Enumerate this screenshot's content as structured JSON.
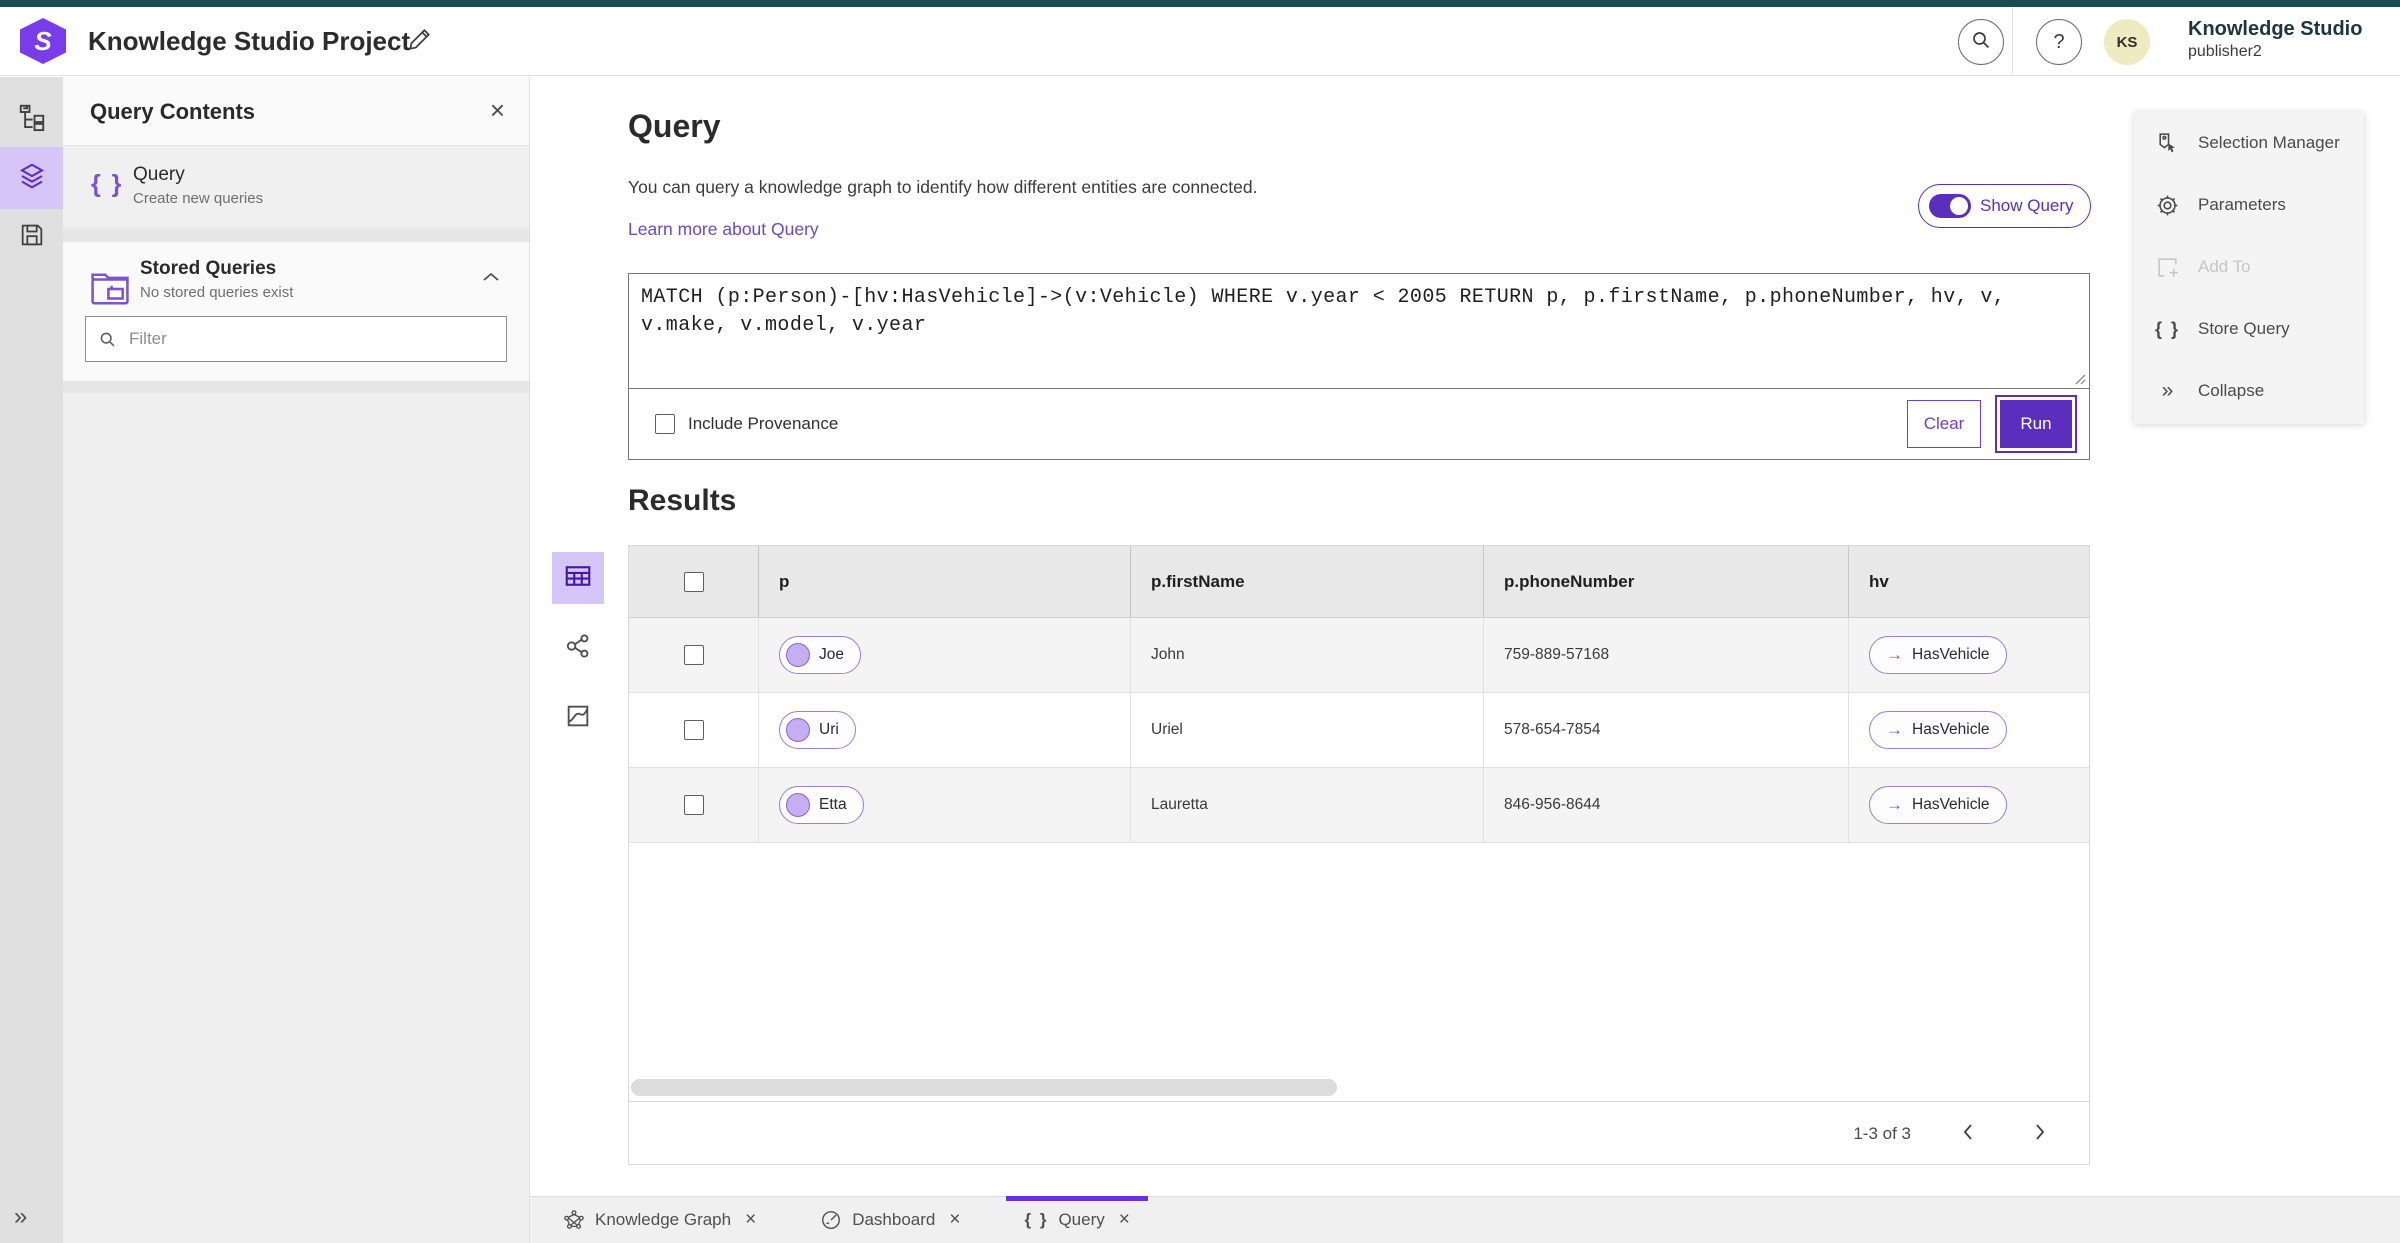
{
  "icons": {
    "close": "×",
    "help": "?",
    "expand": "»",
    "collapse": "»",
    "braces": "{ }",
    "arrow_right": "→"
  },
  "colors": {
    "accent_purple": "#5b2ebe",
    "link_purple": "#6d47c7",
    "rail_active_bg": "#d6c5f7",
    "header_strip_teal": "#1a4b54",
    "pill_border": "#9b7ce0",
    "pill_circle_fill": "#c5aff0",
    "avatar_bg": "#efeabf",
    "tab_indicator": "#6d2ee0"
  },
  "header": {
    "title": "Knowledge Studio Project",
    "user_initials": "KS",
    "user_org": "Knowledge Studio",
    "user_name": "publisher2"
  },
  "panel": {
    "title": "Query Contents",
    "query_item": {
      "title": "Query",
      "subtitle": "Create new queries"
    },
    "stored": {
      "title": "Stored Queries",
      "subtitle": "No stored queries exist"
    },
    "filter_placeholder": "Filter"
  },
  "query_section": {
    "title": "Query",
    "description": "You can query a knowledge graph to identify how different entities are connected.",
    "learn_more": "Learn more about Query",
    "show_query": "Show Query",
    "query_text": "MATCH (p:Person)-[hv:HasVehicle]->(v:Vehicle) WHERE v.year < 2005 RETURN p, p.firstName, p.phoneNumber, hv, v, v.make, v.model, v.year",
    "include_provenance": "Include Provenance",
    "clear": "Clear",
    "run": "Run"
  },
  "results": {
    "title": "Results",
    "columns": [
      "p",
      "p.firstName",
      "p.phoneNumber",
      "hv"
    ],
    "rows": [
      {
        "p": "Joe",
        "firstName": "John",
        "phone": "759-889-57168",
        "hv": "HasVehicle"
      },
      {
        "p": "Uri",
        "firstName": "Uriel",
        "phone": "578-654-7854",
        "hv": "HasVehicle"
      },
      {
        "p": "Etta",
        "firstName": "Lauretta",
        "phone": "846-956-8644",
        "hv": "HasVehicle"
      }
    ],
    "pagination": "1-3 of 3"
  },
  "side_menu": {
    "items": [
      {
        "label": "Selection Manager"
      },
      {
        "label": "Parameters"
      },
      {
        "label": "Add To",
        "disabled": true
      },
      {
        "label": "Store Query"
      },
      {
        "label": "Collapse"
      }
    ]
  },
  "tabs": [
    {
      "label": "Knowledge Graph"
    },
    {
      "label": "Dashboard"
    },
    {
      "label": "Query",
      "active": true
    }
  ]
}
